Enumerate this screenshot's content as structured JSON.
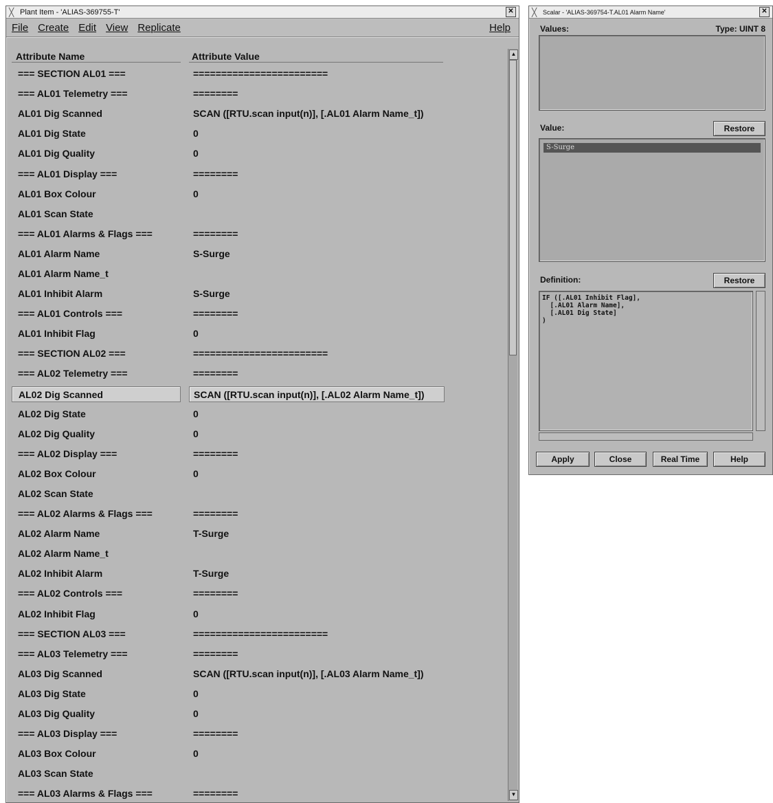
{
  "plant_window": {
    "title": "Plant Item - 'ALIAS-369755-T'",
    "menu": [
      "File",
      "Create",
      "Edit",
      "View",
      "Replicate"
    ],
    "help": "Help",
    "columns": [
      "Attribute Name",
      "Attribute Value"
    ],
    "rows": [
      {
        "name": "=== SECTION AL01 ===",
        "value": "========================"
      },
      {
        "name": "=== AL01 Telemetry ===",
        "value": "========"
      },
      {
        "name": "AL01 Dig Scanned",
        "value": "SCAN ([RTU.scan input(n)], [.AL01 Alarm Name_t])"
      },
      {
        "name": "AL01 Dig State",
        "value": "0"
      },
      {
        "name": "AL01 Dig Quality",
        "value": "0"
      },
      {
        "name": "=== AL01 Display ===",
        "value": "========"
      },
      {
        "name": "AL01 Box Colour",
        "value": "0"
      },
      {
        "name": "AL01 Scan State",
        "value": ""
      },
      {
        "name": "=== AL01 Alarms & Flags ===",
        "value": "========"
      },
      {
        "name": "AL01 Alarm Name",
        "value": "S-Surge"
      },
      {
        "name": "AL01 Alarm Name_t",
        "value": ""
      },
      {
        "name": "AL01 Inhibit Alarm",
        "value": "S-Surge"
      },
      {
        "name": "=== AL01 Controls ===",
        "value": "========"
      },
      {
        "name": "AL01 Inhibit Flag",
        "value": "0"
      },
      {
        "name": "=== SECTION AL02 ===",
        "value": "========================"
      },
      {
        "name": "=== AL02 Telemetry ===",
        "value": "========"
      },
      {
        "name": "AL02 Dig Scanned",
        "value": "SCAN ([RTU.scan input(n)], [.AL02 Alarm Name_t])",
        "selected": true
      },
      {
        "name": "AL02 Dig State",
        "value": "0"
      },
      {
        "name": "AL02 Dig Quality",
        "value": "0"
      },
      {
        "name": "=== AL02 Display ===",
        "value": "========"
      },
      {
        "name": "AL02 Box Colour",
        "value": "0"
      },
      {
        "name": "AL02 Scan State",
        "value": ""
      },
      {
        "name": "=== AL02 Alarms & Flags ===",
        "value": "========"
      },
      {
        "name": "AL02 Alarm Name",
        "value": "T-Surge"
      },
      {
        "name": "AL02 Alarm Name_t",
        "value": ""
      },
      {
        "name": "AL02 Inhibit Alarm",
        "value": "T-Surge"
      },
      {
        "name": "=== AL02 Controls ===",
        "value": "========"
      },
      {
        "name": "AL02 Inhibit Flag",
        "value": "0"
      },
      {
        "name": "=== SECTION AL03 ===",
        "value": "========================"
      },
      {
        "name": "=== AL03 Telemetry ===",
        "value": "========"
      },
      {
        "name": "AL03 Dig Scanned",
        "value": "SCAN ([RTU.scan input(n)], [.AL03 Alarm Name_t])"
      },
      {
        "name": "AL03 Dig State",
        "value": "0"
      },
      {
        "name": "AL03 Dig Quality",
        "value": "0"
      },
      {
        "name": "=== AL03 Display ===",
        "value": "========"
      },
      {
        "name": "AL03 Box Colour",
        "value": "0"
      },
      {
        "name": "AL03 Scan State",
        "value": ""
      },
      {
        "name": "=== AL03 Alarms & Flags ===",
        "value": "========"
      }
    ]
  },
  "scalar_window": {
    "title": "Scalar - 'ALIAS-369754-T.AL01 Alarm Name'",
    "values_label": "Values:",
    "type_label": "Type: UINT 8",
    "value_label": "Value:",
    "value_selected": "S-Surge",
    "restore": "Restore",
    "definition_label": "Definition:",
    "definition_text": "IF ([.AL01 Inhibit Flag],\n  [.AL01 Alarm Name],\n  [.AL01 Dig State]\n)",
    "buttons": [
      "Apply",
      "Close",
      "Real Time",
      "Help"
    ]
  }
}
